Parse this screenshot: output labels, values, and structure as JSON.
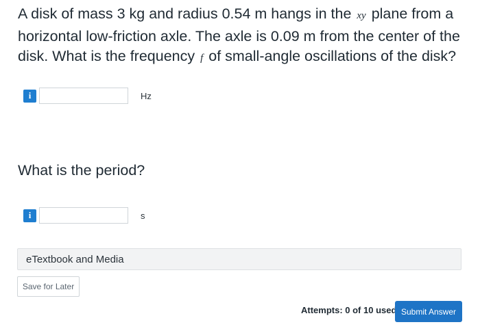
{
  "question": {
    "part1": "A disk of mass 3 kg and radius 0.54 m hangs in the ",
    "var_xy": "xy",
    "part2": " plane from a horizontal low-friction axle. The axle is 0.09 m from the center of the disk. What is the frequency ",
    "var_f": "f",
    "part3": " of small-angle oscillations of the disk?"
  },
  "answers": [
    {
      "info_label": "i",
      "value": "",
      "unit": "Hz"
    },
    {
      "info_label": "i",
      "value": "",
      "unit": "s"
    }
  ],
  "sub_question": "What is the period?",
  "etextbook_label": "eTextbook and Media",
  "save_label": "Save for Later",
  "attempts_text": "Attempts: 0 of 10 used",
  "submit_label": "Submit Answer",
  "colors": {
    "accent": "#1e74c6",
    "info_icon": "#1f7ed0"
  },
  "icons": {
    "info": "info-icon"
  }
}
